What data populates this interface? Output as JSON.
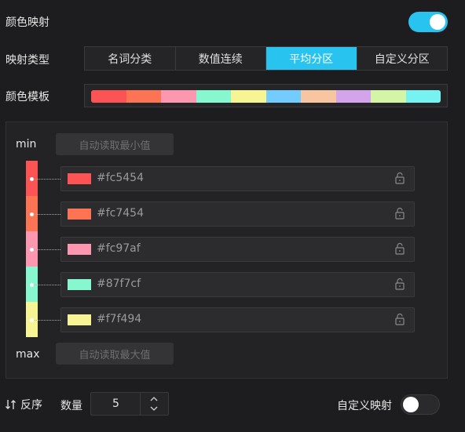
{
  "color_mapping": {
    "label": "颜色映射",
    "enabled": true
  },
  "mapping_type": {
    "label": "映射类型",
    "options": [
      "名词分类",
      "数值连续",
      "平均分区",
      "自定义分区"
    ],
    "selected": "平均分区"
  },
  "color_template": {
    "label": "颜色模板",
    "colors": [
      "#fc5454",
      "#fc7454",
      "#fc97af",
      "#87f7cf",
      "#f7f494",
      "#72ccff",
      "#f7c5a0",
      "#d4a4eb",
      "#d2f5a6",
      "#76f2f2"
    ]
  },
  "range": {
    "min_label": "min",
    "min_button": "自动读取最小值",
    "max_label": "max",
    "max_button": "自动读取最大值"
  },
  "stops": [
    {
      "hex": "#fc5454"
    },
    {
      "hex": "#fc7454"
    },
    {
      "hex": "#fc97af"
    },
    {
      "hex": "#87f7cf"
    },
    {
      "hex": "#f7f494"
    }
  ],
  "footer": {
    "reverse_label": "反序",
    "count_label": "数量",
    "count_value": "5",
    "custom_mapping_label": "自定义映射",
    "custom_mapping_enabled": false
  }
}
